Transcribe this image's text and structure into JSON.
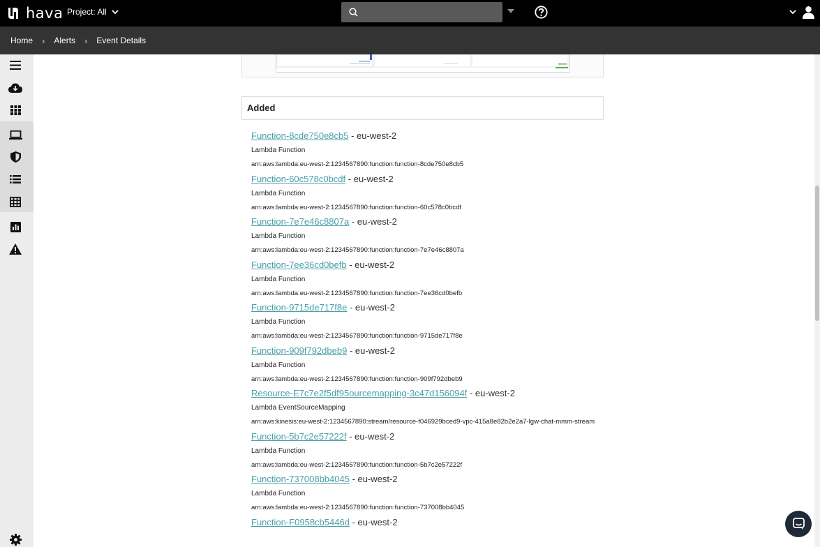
{
  "header": {
    "logo_text": "hava",
    "project_label": "Project: All",
    "search": {
      "placeholder": ""
    }
  },
  "breadcrumb": [
    {
      "label": "Home"
    },
    {
      "label": "Alerts"
    },
    {
      "label": "Event Details"
    }
  ],
  "sidebar": {
    "items": [
      {
        "icon": "menu-icon"
      },
      {
        "icon": "cloud-download-icon"
      },
      {
        "icon": "grid-icon"
      },
      {
        "icon": "laptop-icon"
      },
      {
        "icon": "shield-icon"
      },
      {
        "icon": "list-icon"
      },
      {
        "icon": "table-icon"
      },
      {
        "icon": "bar-chart-icon"
      },
      {
        "icon": "warning-icon"
      }
    ],
    "settings_icon": "gear-icon"
  },
  "section": {
    "title": "Added"
  },
  "resources": [
    {
      "name": "Function-8cde750e8cb5",
      "region": " - eu-west-2",
      "type": "Lambda Function",
      "arn": "arn:aws:lambda:eu-west-2:1234567890:function:function-8cde750e8cb5"
    },
    {
      "name": "Function-60c578c0bcdf",
      "region": " - eu-west-2",
      "type": "Lambda Function",
      "arn": "arn:aws:lambda:eu-west-2:1234567890:function:function-60c578c0bcdf"
    },
    {
      "name": "Function-7e7e46c8807a",
      "region": " - eu-west-2",
      "type": "Lambda Function",
      "arn": "arn:aws:lambda:eu-west-2:1234567890:function:function-7e7e46c8807a"
    },
    {
      "name": "Function-7ee36cd0befb",
      "region": " - eu-west-2",
      "type": "Lambda Function",
      "arn": "arn:aws:lambda:eu-west-2:1234567890:function:function-7ee36cd0befb"
    },
    {
      "name": "Function-9715de717f8e",
      "region": " - eu-west-2",
      "type": "Lambda Function",
      "arn": "arn:aws:lambda:eu-west-2:1234567890:function:function-9715de717f8e"
    },
    {
      "name": "Function-909f792dbeb9",
      "region": " - eu-west-2",
      "type": "Lambda Function",
      "arn": "arn:aws:lambda:eu-west-2:1234567890:function:function-909f792dbeb9"
    },
    {
      "name": "Resource-E7c7e2f5df95ourcemapping-3c47d156094f",
      "region": " - eu-west-2",
      "type": "Lambda EventSourceMapping",
      "arn": "arn:aws:kinesis:eu-west-2:1234567890:stream/resource-f046929bced9-vpc-415a8e82b2e2a7-lgw-chat-mmm-stream"
    },
    {
      "name": "Function-5b7c2e57222f",
      "region": " - eu-west-2",
      "type": "Lambda Function",
      "arn": "arn:aws:lambda:eu-west-2:1234567890:function:function-5b7c2e57222f"
    },
    {
      "name": "Function-737008bb4045",
      "region": " - eu-west-2",
      "type": "Lambda Function",
      "arn": "arn:aws:lambda:eu-west-2:1234567890:function:function-737008bb4045"
    },
    {
      "name": "Function-F0958cb5446d",
      "region": " - eu-west-2",
      "type": "",
      "arn": ""
    }
  ],
  "colors": {
    "topbar": "#000000",
    "breadcrumb_bar": "#333333",
    "sidebar": "#ececec",
    "link": "#4a9fa8"
  }
}
